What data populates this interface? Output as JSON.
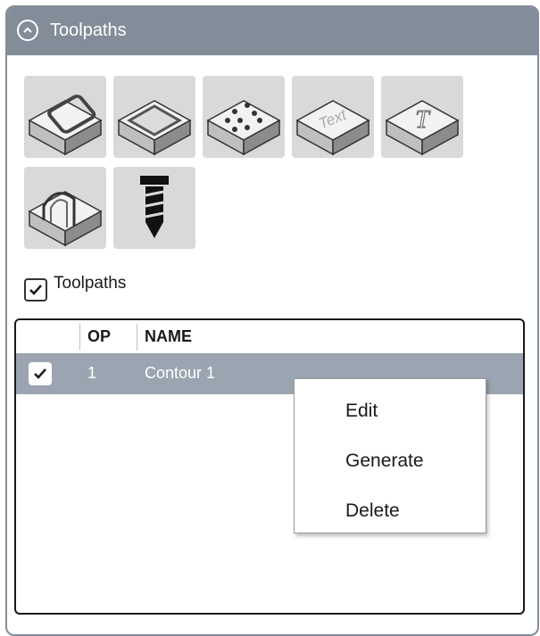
{
  "panel": {
    "title": "Toolpaths",
    "collapse_icon": "chevron-up-circle-icon",
    "header_color": "#838d99"
  },
  "toolbar": {
    "tools": [
      {
        "name": "pocket-tool",
        "icon": "pocket-icon"
      },
      {
        "name": "profile-tool",
        "icon": "profile-icon"
      },
      {
        "name": "drill-pattern-tool",
        "icon": "drill-holes-icon"
      },
      {
        "name": "text-engrave-tool",
        "icon": "text-icon",
        "glyph": "Text"
      },
      {
        "name": "vcarve-text-tool",
        "icon": "vcarve-text-icon",
        "glyph": "T"
      },
      {
        "name": "arch-cut-tool",
        "icon": "arch-icon"
      },
      {
        "name": "drill-tool",
        "icon": "drill-bit-icon"
      }
    ]
  },
  "toolpaths_toggle": {
    "label": "Toolpaths",
    "checked": true
  },
  "list": {
    "columns": [
      "OP",
      "NAME"
    ],
    "rows": [
      {
        "checked": true,
        "op": "1",
        "name": "Contour 1",
        "selected": true
      }
    ],
    "selected_row_color": "#9aa5b1"
  },
  "context_menu": {
    "items": [
      "Edit",
      "Generate",
      "Delete"
    ]
  }
}
